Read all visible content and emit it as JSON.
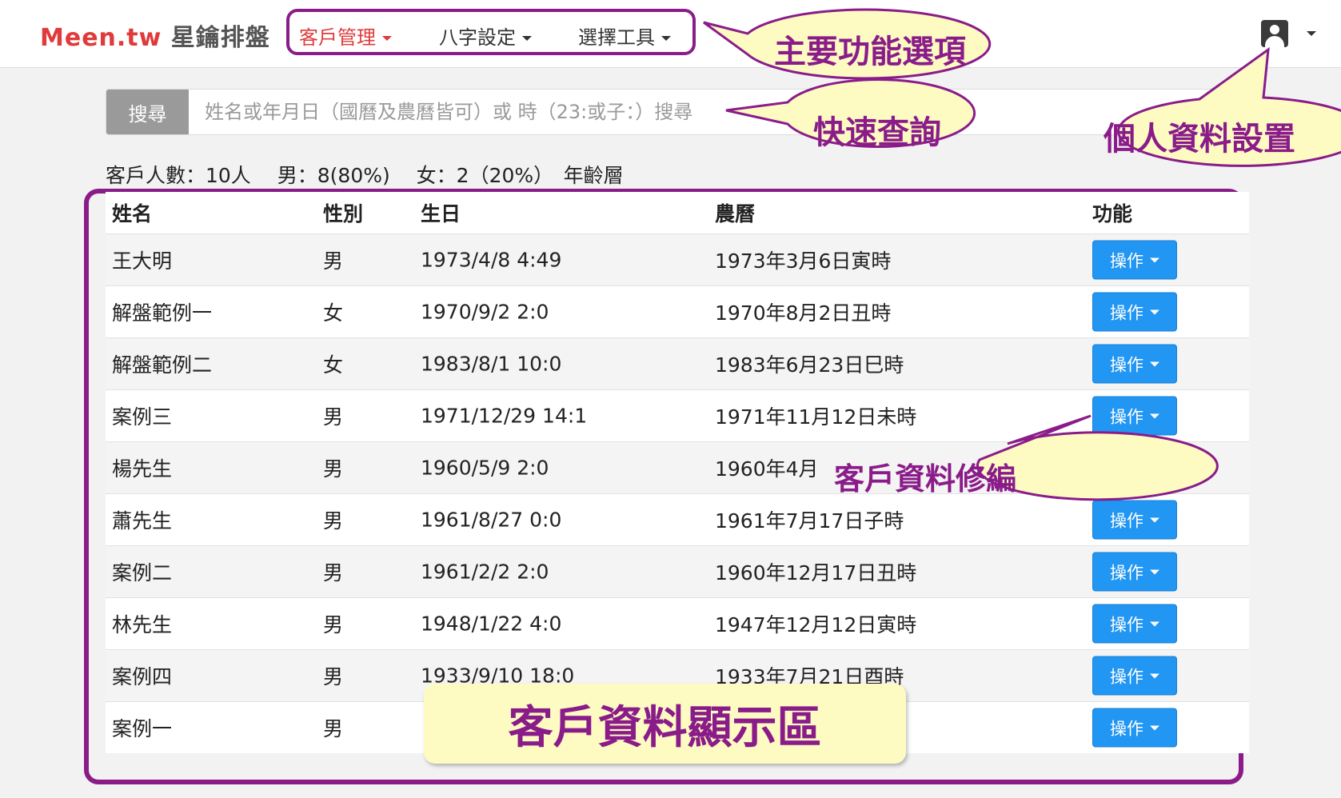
{
  "navbar": {
    "brand_en": "Meen.tw",
    "brand_zh": " 星鑰排盤",
    "menu": [
      {
        "label": "客戶管理",
        "active": true
      },
      {
        "label": "八字設定",
        "active": false
      },
      {
        "label": "選擇工具",
        "active": false
      }
    ],
    "user_icon": "user-account-icon"
  },
  "search": {
    "button_label": "搜尋",
    "placeholder": "姓名或年月日（國曆及農曆皆可）或 時（23:或子：）搜尋"
  },
  "stats": "客戶人數：10人　 男：8(80%)　 女：2（20%）　年齡層",
  "table": {
    "headers": {
      "name": "姓名",
      "gender": "性別",
      "birth": "生日",
      "lunar": "農曆",
      "func": "功能"
    },
    "op_label": "操作",
    "rows": [
      {
        "name": "王大明",
        "gender": "男",
        "birth": "1973/4/8 4:49",
        "lunar": "1973年3月6日寅時"
      },
      {
        "name": "解盤範例一",
        "gender": "女",
        "birth": "1970/9/2 2:0",
        "lunar": "1970年8月2日丑時"
      },
      {
        "name": "解盤範例二",
        "gender": "女",
        "birth": "1983/8/1 10:0",
        "lunar": "1983年6月23日巳時"
      },
      {
        "name": "案例三",
        "gender": "男",
        "birth": "1971/12/29 14:1",
        "lunar": "1971年11月12日未時"
      },
      {
        "name": "楊先生",
        "gender": "男",
        "birth": "1960/5/9 2:0",
        "lunar": "1960年4月"
      },
      {
        "name": "蕭先生",
        "gender": "男",
        "birth": "1961/8/27 0:0",
        "lunar": "1961年7月17日子時"
      },
      {
        "name": "案例二",
        "gender": "男",
        "birth": "1961/2/2 2:0",
        "lunar": "1960年12月17日丑時"
      },
      {
        "name": "林先生",
        "gender": "男",
        "birth": "1948/1/22 4:0",
        "lunar": "1947年12月12日寅時"
      },
      {
        "name": "案例四",
        "gender": "男",
        "birth": "1933/9/10 18:0",
        "lunar": "1933年7月21日酉時"
      },
      {
        "name": "案例一",
        "gender": "男",
        "birth": "",
        "lunar": ""
      }
    ]
  },
  "annotations": {
    "main_menu": "主要功能選項",
    "quick_search": "快速查詢",
    "profile": "個人資料設置",
    "edit": "客戶資料修編",
    "display_area": "客戶資料顯示區"
  },
  "colors": {
    "accent": "#e03a3a",
    "button": "#2196f3",
    "annotation": "#8a1c8a",
    "callout_fill": "#fdfbc2"
  }
}
